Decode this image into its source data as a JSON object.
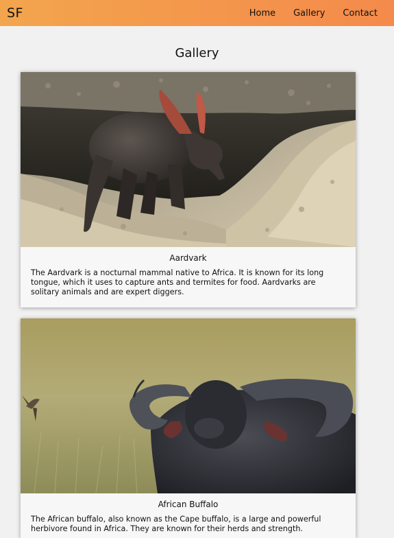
{
  "brand": "SF",
  "nav": {
    "home": "Home",
    "gallery": "Gallery",
    "contact": "Contact"
  },
  "page_title": "Gallery",
  "cards": [
    {
      "title": "Aardvark",
      "description": "The Aardvark is a nocturnal mammal native to Africa. It is known for its long tongue, which it uses to capture ants and termites for food. Aardvarks are solitary animals and are expert diggers."
    },
    {
      "title": "African Buffalo",
      "description": "The African buffalo, also known as the Cape buffalo, is a large and powerful herbivore found in Africa. They are known for their herds and strength."
    }
  ],
  "colors": {
    "header_start": "#f3a54d",
    "header_end": "#f48a4b",
    "background": "#f1f1f1",
    "card_background": "#f7f7f7"
  }
}
